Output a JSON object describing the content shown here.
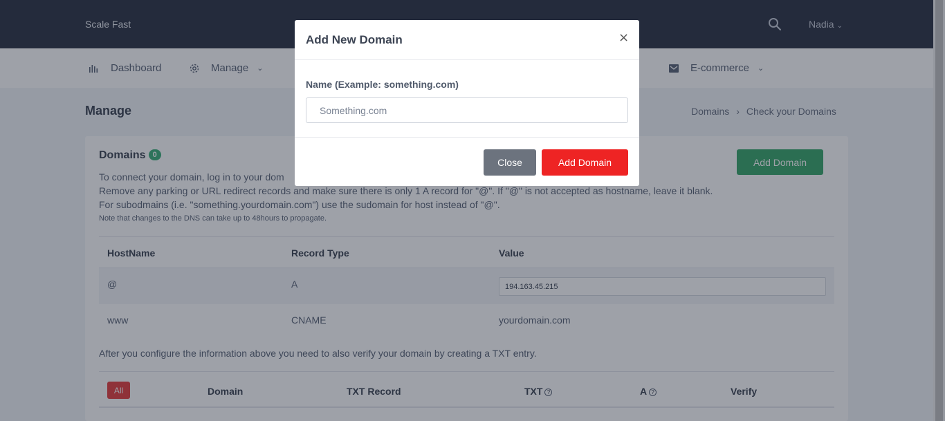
{
  "app": {
    "brand": "Scale Fast",
    "user": "Nadia"
  },
  "nav": {
    "items": [
      {
        "label": "Dashboard",
        "icon": "bar-chart-icon"
      },
      {
        "label": "Manage",
        "icon": "gear-icon"
      },
      {
        "label": "E-commerce",
        "icon": "envelope-icon"
      }
    ]
  },
  "page": {
    "title": "Manage",
    "breadcrumb": [
      "Domains",
      "Check your Domains"
    ]
  },
  "domains": {
    "title": "Domains",
    "count": "0",
    "add_button": "Add Domain",
    "info": [
      "To connect your domain, log in to your dom",
      "Remove any parking or URL redirect records and make sure there is only 1 A record for \"@\". If \"@\" is not accepted as hostname, leave it blank.",
      "For subodmains (i.e. \"something.yourdomain.com\") use the sudomain for host instead of \"@\"."
    ],
    "note": "Note that changes to the DNS can take up to 48hours to propagate.",
    "dns_table": {
      "headers": [
        "HostName",
        "Record Type",
        "Value"
      ],
      "rows": [
        {
          "host": "@",
          "type": "A",
          "value": "194.163.45.215"
        },
        {
          "host": "www",
          "type": "CNAME",
          "value": "yourdomain.com"
        }
      ]
    },
    "verify_info": "After you configure the information above you need to also verify your domain by creating a TXT entry.",
    "list_table": {
      "filter": "All",
      "headers": [
        "Domain",
        "TXT Record",
        "TXT",
        "A",
        "Verify"
      ]
    }
  },
  "modal": {
    "title": "Add New Domain",
    "close_glyph": "×",
    "label": "Name (Example: something.com)",
    "placeholder": "Something.com",
    "close_button": "Close",
    "add_button": "Add Domain"
  }
}
